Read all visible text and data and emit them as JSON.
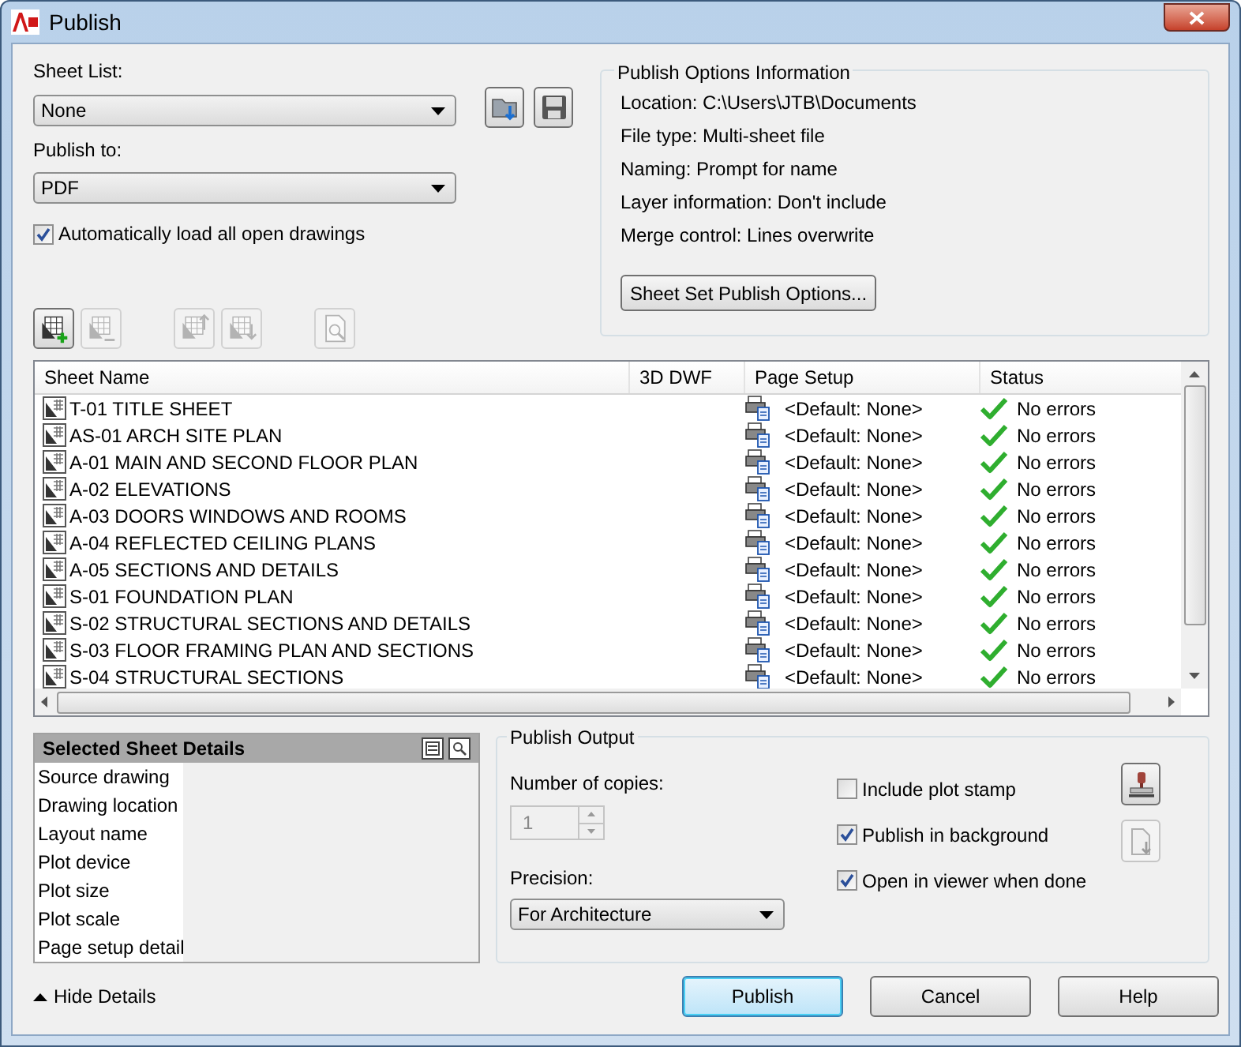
{
  "window": {
    "title": "Publish"
  },
  "sheet_list": {
    "label": "Sheet List:",
    "value": "None"
  },
  "publish_to": {
    "label": "Publish to:",
    "value": "PDF"
  },
  "auto_load": {
    "label": "Automatically load all open drawings",
    "checked": true
  },
  "toolbar": [
    {
      "kind": "add",
      "disabled": false
    },
    {
      "kind": "remove",
      "disabled": true
    },
    {
      "kind": "up",
      "disabled": true
    },
    {
      "kind": "down",
      "disabled": true
    },
    {
      "kind": "preview",
      "disabled": true
    }
  ],
  "publish_options": {
    "title": "Publish Options Information",
    "lines": [
      "Location: C:\\Users\\JTB\\Documents",
      "File type: Multi-sheet file",
      "Naming: Prompt for name",
      "Layer information: Don't include",
      "Merge control: Lines overwrite"
    ],
    "button": "Sheet Set Publish Options..."
  },
  "table": {
    "columns": [
      "Sheet Name",
      "3D DWF",
      "Page Setup",
      "Status"
    ],
    "rows": [
      {
        "sheet_name": "T-01 TITLE SHEET",
        "page_setup": "<Default: None>",
        "status": "No errors"
      },
      {
        "sheet_name": "AS-01 ARCH SITE PLAN",
        "page_setup": "<Default: None>",
        "status": "No errors"
      },
      {
        "sheet_name": "A-01 MAIN AND SECOND FLOOR PLAN",
        "page_setup": "<Default: None>",
        "status": "No errors"
      },
      {
        "sheet_name": "A-02 ELEVATIONS",
        "page_setup": "<Default: None>",
        "status": "No errors"
      },
      {
        "sheet_name": "A-03 DOORS WINDOWS AND ROOMS",
        "page_setup": "<Default: None>",
        "status": "No errors"
      },
      {
        "sheet_name": "A-04 REFLECTED CEILING PLANS",
        "page_setup": "<Default: None>",
        "status": "No errors"
      },
      {
        "sheet_name": "A-05 SECTIONS AND DETAILS",
        "page_setup": "<Default: None>",
        "status": "No errors"
      },
      {
        "sheet_name": "S-01 FOUNDATION PLAN",
        "page_setup": "<Default: None>",
        "status": "No errors"
      },
      {
        "sheet_name": "S-02 STRUCTURAL SECTIONS AND DETAILS",
        "page_setup": "<Default: None>",
        "status": "No errors"
      },
      {
        "sheet_name": "S-03 FLOOR FRAMING PLAN AND SECTIONS",
        "page_setup": "<Default: None>",
        "status": "No errors"
      },
      {
        "sheet_name": "S-04 STRUCTURAL SECTIONS",
        "page_setup": "<Default: None>",
        "status": "No errors"
      }
    ]
  },
  "details": {
    "title": "Selected Sheet Details",
    "rows": [
      "Source drawing",
      "Drawing location",
      "Layout name",
      "Plot device",
      "Plot size",
      "Plot scale",
      "Page setup detail"
    ]
  },
  "publish_output": {
    "title": "Publish Output",
    "copies": {
      "label": "Number of copies:",
      "value": "1",
      "disabled": true
    },
    "precision": {
      "label": "Precision:",
      "value": "For Architecture"
    },
    "options": [
      {
        "label": "Include plot stamp",
        "checked": false
      },
      {
        "label": "Publish in background",
        "checked": true
      },
      {
        "label": "Open in viewer when done",
        "checked": true
      }
    ],
    "side_buttons": [
      {
        "kind": "stamp",
        "disabled": false
      },
      {
        "kind": "settings",
        "disabled": true
      }
    ]
  },
  "hide_details": "Hide Details",
  "buttons": [
    {
      "label": "Publish",
      "default": true
    },
    {
      "label": "Cancel",
      "default": false
    },
    {
      "label": "Help",
      "default": false
    }
  ]
}
